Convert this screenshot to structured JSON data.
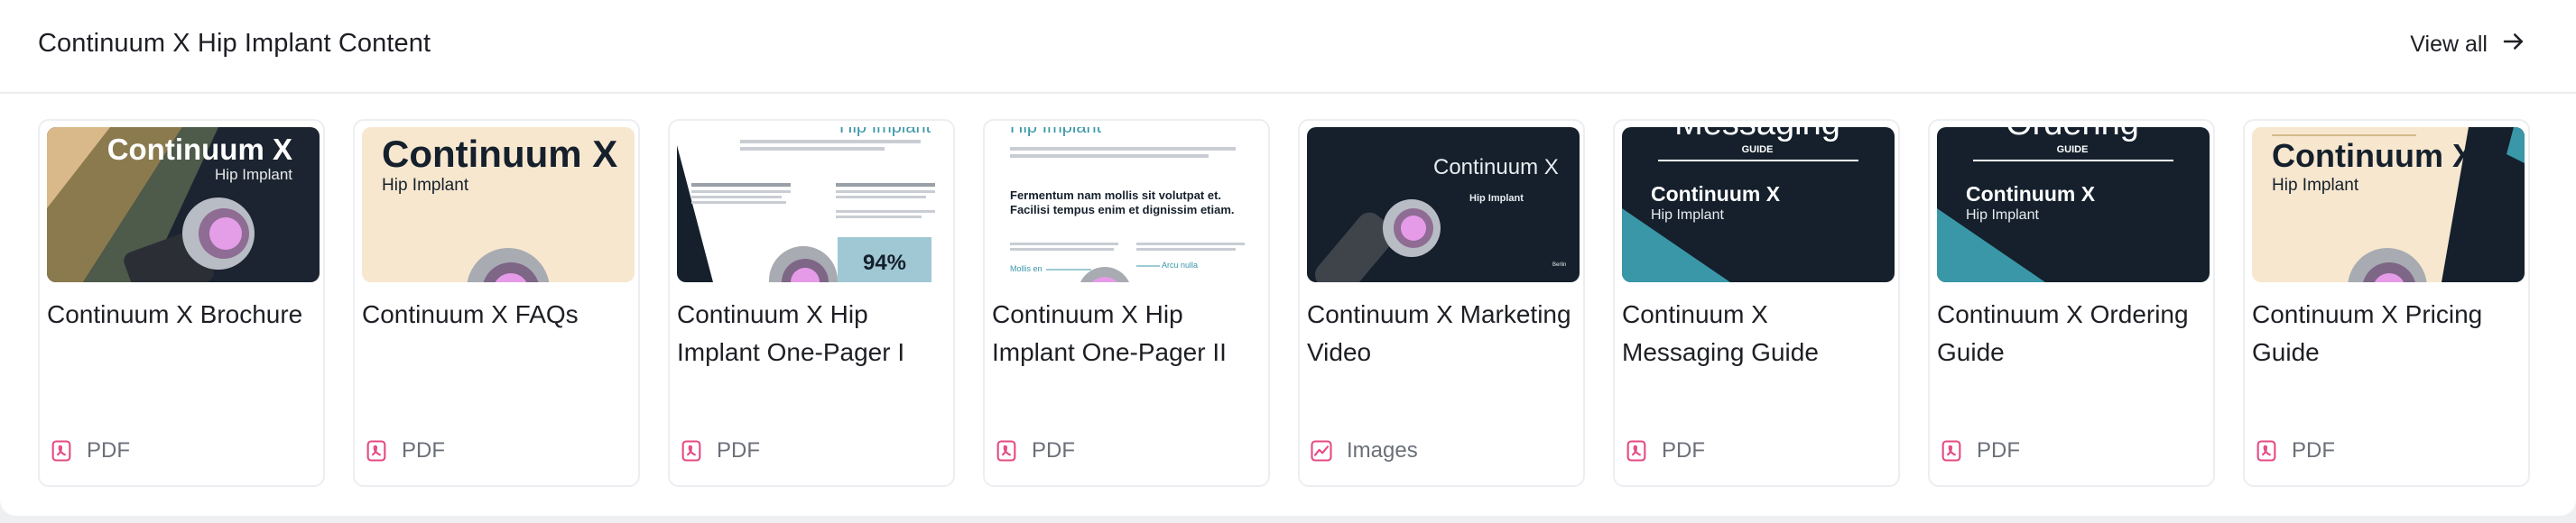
{
  "section": {
    "title": "Continuum X Hip Implant Content",
    "view_all_label": "View all"
  },
  "colors": {
    "accent_pink": "#e54a82",
    "navy": "#15202c",
    "teal": "#3a97a8",
    "cream": "#f7e7cf"
  },
  "cards": [
    {
      "title": "Continuum X Brochure",
      "type": "PDF",
      "icon": "pdf-icon",
      "thumb": {
        "heading": "Continuum X",
        "sub": "Hip Implant"
      }
    },
    {
      "title": "Continuum X FAQs",
      "type": "PDF",
      "icon": "pdf-icon",
      "thumb": {
        "heading": "Continuum X",
        "sub": "Hip Implant"
      }
    },
    {
      "title": "Continuum X Hip Implant One-Pager I",
      "type": "PDF",
      "icon": "pdf-icon",
      "thumb": {
        "heading": "Hip Implant",
        "stat": "94%"
      }
    },
    {
      "title": "Continuum X Hip Implant One-Pager II",
      "type": "PDF",
      "icon": "pdf-icon",
      "thumb": {
        "heading": "Hip Implant",
        "body": "Fermentum nam mollis sit volutpat et. Facilisi tempus enim et dignissim etiam.",
        "left_label": "Mollis en",
        "right_label": "Arcu nulla"
      }
    },
    {
      "title": "Continuum X Marketing Video",
      "type": "Images",
      "icon": "image-icon",
      "thumb": {
        "heading": "Continuum X",
        "sub": "Hip Implant",
        "footer": "Berlin"
      }
    },
    {
      "title": "Continuum X Messaging Guide",
      "type": "PDF",
      "icon": "pdf-icon",
      "thumb": {
        "top": "Messaging",
        "guide": "GUIDE",
        "heading": "Continuum X",
        "sub": "Hip Implant"
      }
    },
    {
      "title": "Continuum X Ordering Guide",
      "type": "PDF",
      "icon": "pdf-icon",
      "thumb": {
        "top": "Ordering",
        "guide": "GUIDE",
        "heading": "Continuum X",
        "sub": "Hip Implant"
      }
    },
    {
      "title": "Continuum X Pricing Guide",
      "type": "PDF",
      "icon": "pdf-icon",
      "thumb": {
        "heading": "Continuum X",
        "sub": "Hip Implant"
      }
    }
  ]
}
